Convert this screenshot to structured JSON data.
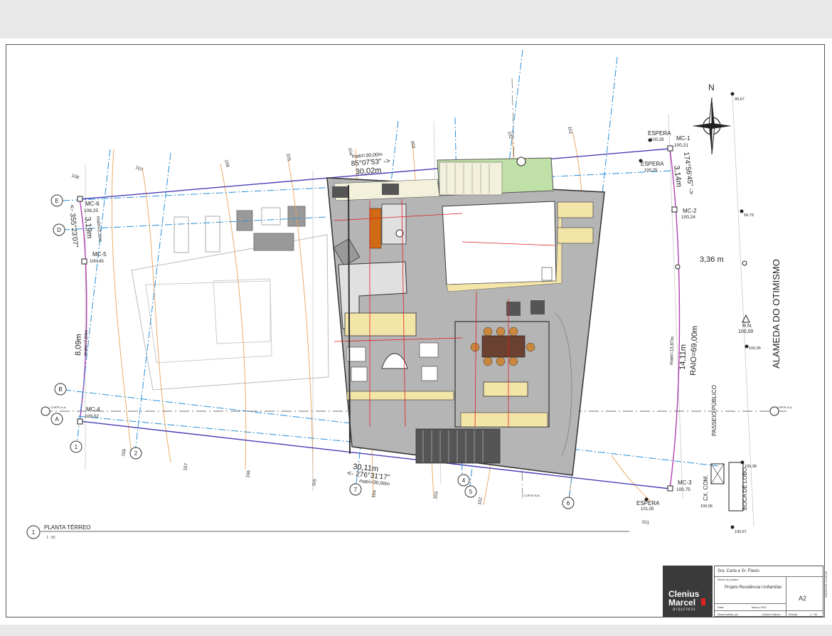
{
  "drawing": {
    "title": "PLANTA TÉRREO",
    "scale": "1 : 50",
    "view_number": "1",
    "street_name": "ALAMEDA DO OTIMISMO",
    "passeio": "PASSEIO PÚBLICO",
    "boca_lobo": "BOCA DE LOBO",
    "cx_com": "CX. COM.",
    "north": "N",
    "corte_aa": "CORTE A-A",
    "corte_bb": "CORTE B-B"
  },
  "grid_axes": {
    "letters": [
      "E",
      "D",
      "B",
      "A"
    ],
    "numbers": [
      "1",
      "2",
      "4",
      "5",
      "6",
      "7"
    ]
  },
  "markers": {
    "mc1": {
      "label": "MC-1",
      "value": "100,21"
    },
    "mc2": {
      "label": "MC-2",
      "value": "100,24"
    },
    "mc3": {
      "label": "MC-3",
      "value": "100,75"
    },
    "mc4": {
      "label": "MC-4",
      "value": "109,02"
    },
    "mc5": {
      "label": "MC-5",
      "value": "100,45"
    },
    "mc6": {
      "label": "MC-6",
      "value": "108,25"
    },
    "espera1": {
      "label": "ESPERA",
      "value": "100,28"
    },
    "espera2": {
      "label": "ESPERA",
      "value": "100,25"
    },
    "espera3": {
      "label": "ESPERA",
      "value": "101,05"
    },
    "rn": {
      "label": "R.N.",
      "value": "100,00"
    }
  },
  "dimensions": {
    "top_matri": "matri=30,00m",
    "top_angle": "85°07'53\" ->",
    "top_length": "30,02m",
    "bottom_length": "30,11m",
    "bottom_angle": "<- 276°31'17\"",
    "bottom_matri": "matri=30,00m",
    "left_angle": "<- 355°23'07\"",
    "left_length": "3,19m",
    "left_matri": "matri=3,16m",
    "left_side": "8,09m",
    "left_side_matri": "matri=7,84m",
    "right_angle": "174°56'45\" ->",
    "right_length": "3,14m",
    "right_width": "3,36 m",
    "arc_length": "14,11m",
    "arc_radius": "RAIO=69,00m",
    "arc_matri": "matri=13,87m"
  },
  "levels": {
    "street": [
      "99,67",
      "99,79",
      "100,05",
      "100,38",
      "100,67"
    ],
    "cx": "100,58",
    "contours": [
      "108",
      "107",
      "106",
      "105",
      "104",
      "103",
      "102",
      "101",
      "100",
      "109"
    ]
  },
  "title_block": {
    "client": "Sra. Carla e Sr. Flavio",
    "project_label": "Nome do projeto",
    "project": "Projeto Residência Unifamiliar",
    "sheet": "A2",
    "date_label": "Data",
    "date": "Março 2021",
    "drawn_label": "Desenhadas por",
    "drawn": "Clenius Marcel",
    "scale_label": "Escala",
    "scale": "1 : 50",
    "side_code": "06/03/2021 13:25:38"
  },
  "logo": {
    "line1": "Clenius",
    "line2": "Marcel",
    "line3": "arquiteto"
  },
  "colors": {
    "floor": "#b5b5b5",
    "grass": "#bfe0a6",
    "axis_blue": "#2b8fd6",
    "boundary": "#4a3fb5",
    "contour": "#e9a25a",
    "red_dim": "#e02020",
    "arc": "#b040b0"
  }
}
